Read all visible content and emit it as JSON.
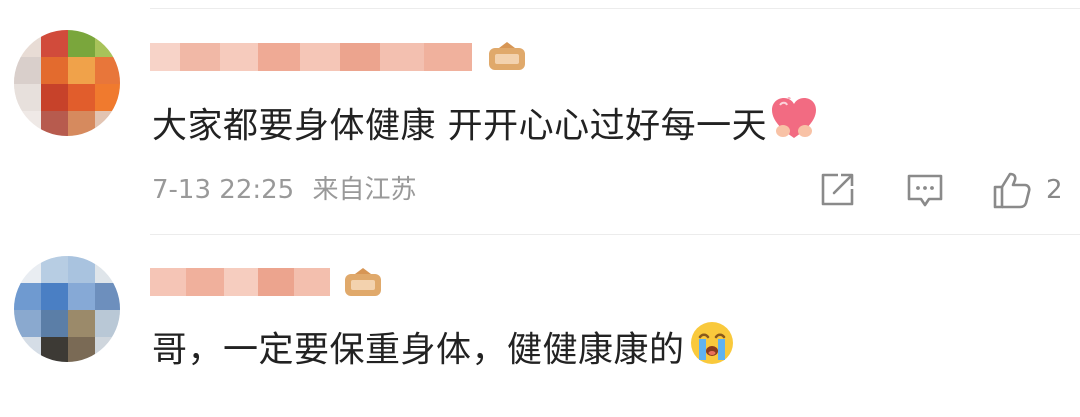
{
  "comments": [
    {
      "text": "大家都要身体健康 开开心心过好每一天",
      "text_emoji": "heart-emoji",
      "timestamp": "7-13 22:25",
      "location": "来自江苏",
      "like_count": "2",
      "actions": [
        "share-icon",
        "reply-icon",
        "like-icon"
      ]
    },
    {
      "text": "哥，一定要保重身体，健健康康的",
      "text_emoji": "crying-emoji"
    }
  ],
  "colors": {
    "text": "#222222",
    "meta": "#999999",
    "divider": "#ececec",
    "badge": "#e0a96b"
  }
}
